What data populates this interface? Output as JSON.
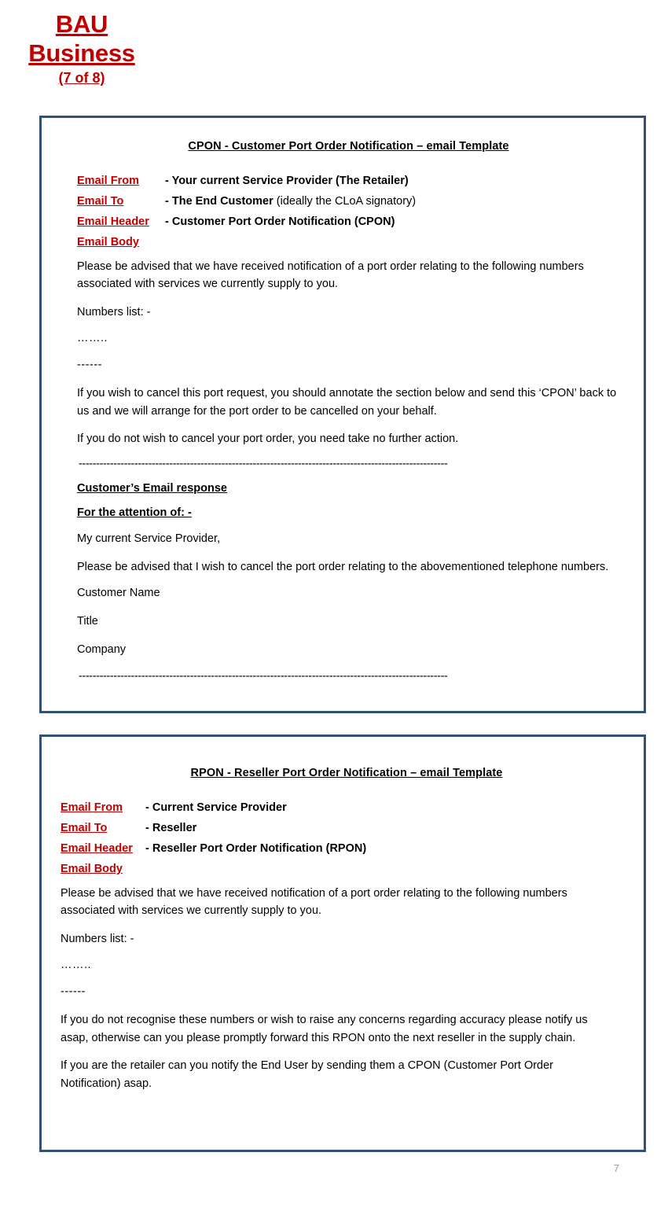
{
  "slide": {
    "title_line1": "BAU",
    "title_line2": "Business",
    "title_line3": "(7 of 8)",
    "title_color": "#C00000",
    "page_number": "7",
    "box_border_color": "#32517A"
  },
  "cpon": {
    "heading": "CPON - Customer Port Order Notification – email Template",
    "fields": [
      {
        "label": "Email From",
        "value_strong": "- Your current Service Provider (The Retailer)",
        "value_plain": ""
      },
      {
        "label": "Email To",
        "value_strong": "- The End Customer ",
        "value_plain": "(ideally the CLoA signatory)"
      },
      {
        "label": "Email Header",
        "value_strong": "- Customer Port Order Notification (CPON)",
        "value_plain": ""
      },
      {
        "label": "Email Body",
        "value_strong": "",
        "value_plain": ""
      }
    ],
    "para1": "Please be advised that we have received notification of a port order relating to the following numbers associated with services we currently supply to you.",
    "numbers_list_label": "Numbers list: -",
    "dots": "……..",
    "dashes": "------",
    "para2": "If you wish to cancel this port request, you should annotate the section below and send this ‘CPON’ back to us and we will arrange for the port order to be cancelled on your behalf.",
    "para3": "If you do not wish to cancel your port order, you need take no further action.",
    "rule_top": " ----------------------------------------------------------------------------------------------------------",
    "response_heading": "Customer’s Email response",
    "attention_heading": "For the attention of: -",
    "salutation": "My current Service Provider,",
    "para4": "Please be advised that I wish to cancel the port order relating to the abovementioned telephone numbers.",
    "sig_name": "Customer Name",
    "sig_title": "Title",
    "sig_company": "Company",
    "rule_bottom": "----------------------------------------------------------------------------------------------------------"
  },
  "rpon": {
    "heading": "RPON - Reseller Port Order Notification – email Template",
    "fields": [
      {
        "label": "Email From",
        "value_strong": "- Current Service Provider",
        "value_plain": ""
      },
      {
        "label": "Email To",
        "value_strong": "- Reseller",
        "value_plain": ""
      },
      {
        "label": "Email Header",
        "value_strong": "- Reseller Port Order Notification (RPON)",
        "value_plain": ""
      },
      {
        "label": "Email Body",
        "value_strong": "",
        "value_plain": ""
      }
    ],
    "para1": "Please be advised that we have received notification of a port order relating to the following numbers associated with services we currently supply to you.",
    "numbers_list_label": "Numbers list: -",
    "dots": "……..",
    "dashes": "------",
    "para2": "If you do not recognise these numbers or wish to raise any concerns regarding accuracy please notify us asap, otherwise can you please promptly forward this RPON onto the next reseller in the supply chain.",
    "para3": "If you are the retailer can you notify the End User by sending them a CPON (Customer Port Order Notification) asap."
  }
}
